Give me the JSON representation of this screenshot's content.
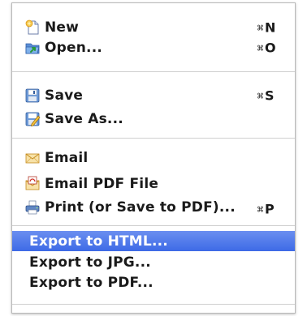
{
  "menu": {
    "items": [
      {
        "label": "New",
        "shortcut": "N",
        "modifier": "⌘",
        "icon": "new-document-icon"
      },
      {
        "label": "Open...",
        "shortcut": "O",
        "modifier": "⌘",
        "icon": "open-folder-icon"
      },
      {
        "label": "Save",
        "shortcut": "S",
        "modifier": "⌘",
        "icon": "save-floppy-icon"
      },
      {
        "label": "Save As...",
        "icon": "save-as-pencil-icon"
      },
      {
        "label": "Email",
        "icon": "email-envelope-icon"
      },
      {
        "label": "Email PDF File",
        "icon": "email-pdf-icon"
      },
      {
        "label": "Print (or Save to PDF)...",
        "shortcut": "P",
        "modifier": "⌘",
        "icon": "printer-icon"
      },
      {
        "label": "Export to HTML...",
        "selected": true
      },
      {
        "label": "Export to JPG..."
      },
      {
        "label": "Export to PDF..."
      }
    ]
  },
  "colors": {
    "selection": "#4a74ea",
    "separator": "#cfcfcf",
    "text": "#1a1a1a"
  }
}
